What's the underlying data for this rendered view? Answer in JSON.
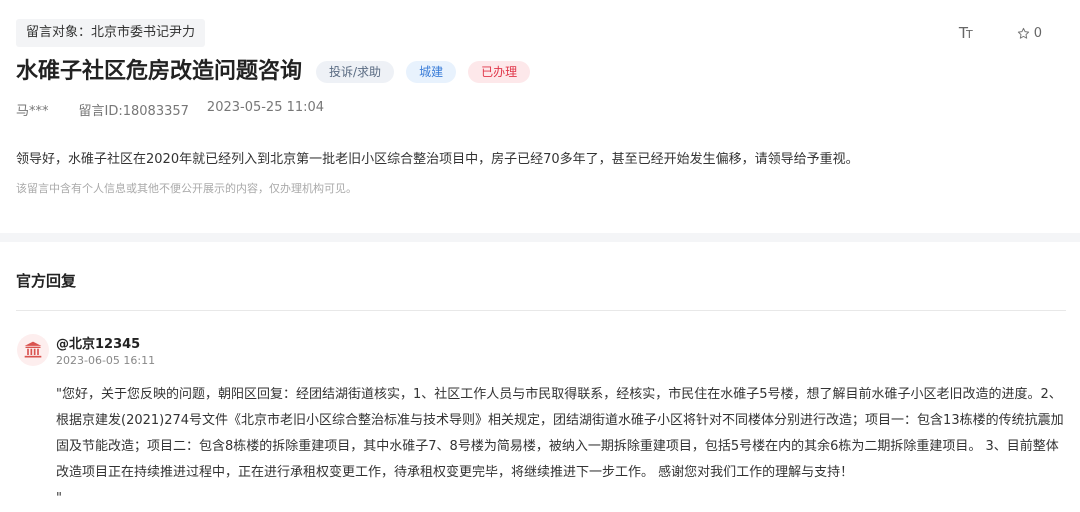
{
  "message": {
    "recipient": "留言对象：北京市委书记尹力",
    "title": "水碓子社区危房改造问题咨询",
    "tags": {
      "type": "投诉/求助",
      "domain": "城建",
      "status": "已办理"
    },
    "author": "马***",
    "id_label": "留言ID:18083357",
    "datetime": "2023-05-25 11:04",
    "content": "领导好，水碓子社区在2020年就已经列入到北京第一批老旧小区综合整治项目中，房子已经70多年了，甚至已经开始发生偏移，请领导给予重视。",
    "privacy_note": "该留言中含有个人信息或其他不便公开展示的内容，仅办理机构可见。"
  },
  "toolbar": {
    "font_size_big": "T",
    "font_size_small": "T",
    "favorite_count": "0"
  },
  "reply": {
    "section_title": "官方回复",
    "replier": "@北京12345",
    "datetime": "2023-06-05 16:11",
    "body": "\"您好，关于您反映的问题，朝阳区回复：经团结湖街道核实，1、社区工作人员与市民取得联系，经核实，市民住在水碓子5号楼，想了解目前水碓子小区老旧改造的进度。2、根据京建发(2021)274号文件《北京市老旧小区综合整治标准与技术导则》相关规定，团结湖街道水碓子小区将针对不同楼体分别进行改造；项目一：包含13栋楼的传统抗震加固及节能改造；项目二：包含8栋楼的拆除重建项目，其中水碓子7、8号楼为简易楼，被纳入一期拆除重建项目，包括5号楼在内的其余6栋为二期拆除重建项目。 3、目前整体改造项目正在持续推进过程中，正在进行承租权变更工作，待承租权变更完毕，将继续推进下一步工作。 感谢您对我们工作的理解与支持！\n\""
  },
  "icons": {
    "font_size": "font-size-icon",
    "favorite": "star-outline-icon",
    "avatar": "government-building-icon"
  },
  "colors": {
    "status_red": "#e0374a",
    "domain_blue": "#3b7dd8",
    "type_gray": "#5a6b82"
  }
}
